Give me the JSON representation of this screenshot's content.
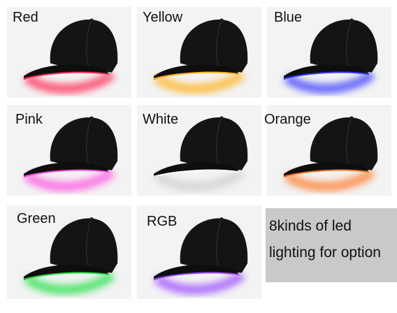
{
  "hats": [
    {
      "label": "Red",
      "color": "#ff2a55"
    },
    {
      "label": "Yellow",
      "color": "#ffb21e"
    },
    {
      "label": "Blue",
      "color": "#3a3cff"
    },
    {
      "label": "Pink",
      "color": "#ff4fe0"
    },
    {
      "label": "White",
      "color": "#ffffff"
    },
    {
      "label": "Orange",
      "color": "#ff7a2a"
    },
    {
      "label": "Green",
      "color": "#28e04a"
    },
    {
      "label": "RGB",
      "color": "#9b4bff"
    }
  ],
  "info": {
    "line1": "8kinds of led",
    "line2": "lighting for option"
  }
}
